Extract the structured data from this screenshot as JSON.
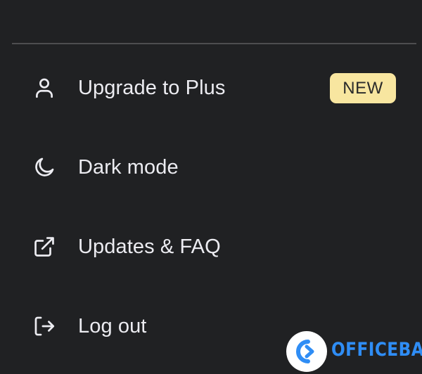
{
  "menu": {
    "items": [
      {
        "label": "Upgrade to Plus",
        "icon": "user-icon",
        "badge": "NEW"
      },
      {
        "label": "Dark mode",
        "icon": "moon-icon"
      },
      {
        "label": "Updates & FAQ",
        "icon": "external-link-icon"
      },
      {
        "label": "Log out",
        "icon": "log-out-icon"
      }
    ]
  },
  "watermark": {
    "text": "OFFICEBA"
  },
  "colors": {
    "background": "#202123",
    "text": "#ececf1",
    "badge_bg": "#f8e6a0",
    "divider": "#4d4d4f",
    "watermark_blue": "#2f8df5"
  }
}
